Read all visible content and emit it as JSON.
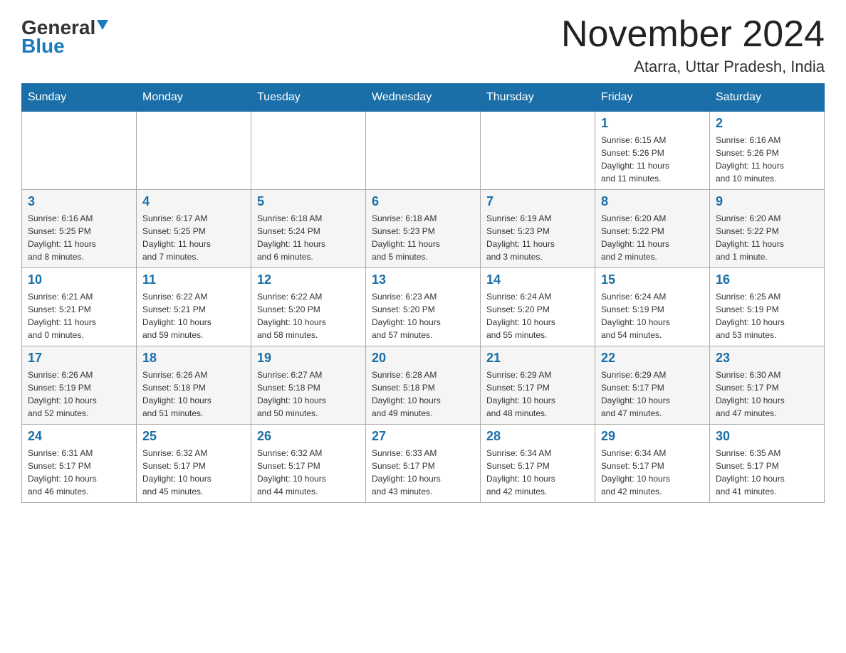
{
  "header": {
    "logo_general": "General",
    "logo_blue": "Blue",
    "month_title": "November 2024",
    "location": "Atarra, Uttar Pradesh, India"
  },
  "weekdays": [
    "Sunday",
    "Monday",
    "Tuesday",
    "Wednesday",
    "Thursday",
    "Friday",
    "Saturday"
  ],
  "weeks": [
    [
      {
        "day": "",
        "info": ""
      },
      {
        "day": "",
        "info": ""
      },
      {
        "day": "",
        "info": ""
      },
      {
        "day": "",
        "info": ""
      },
      {
        "day": "",
        "info": ""
      },
      {
        "day": "1",
        "info": "Sunrise: 6:15 AM\nSunset: 5:26 PM\nDaylight: 11 hours\nand 11 minutes."
      },
      {
        "day": "2",
        "info": "Sunrise: 6:16 AM\nSunset: 5:26 PM\nDaylight: 11 hours\nand 10 minutes."
      }
    ],
    [
      {
        "day": "3",
        "info": "Sunrise: 6:16 AM\nSunset: 5:25 PM\nDaylight: 11 hours\nand 8 minutes."
      },
      {
        "day": "4",
        "info": "Sunrise: 6:17 AM\nSunset: 5:25 PM\nDaylight: 11 hours\nand 7 minutes."
      },
      {
        "day": "5",
        "info": "Sunrise: 6:18 AM\nSunset: 5:24 PM\nDaylight: 11 hours\nand 6 minutes."
      },
      {
        "day": "6",
        "info": "Sunrise: 6:18 AM\nSunset: 5:23 PM\nDaylight: 11 hours\nand 5 minutes."
      },
      {
        "day": "7",
        "info": "Sunrise: 6:19 AM\nSunset: 5:23 PM\nDaylight: 11 hours\nand 3 minutes."
      },
      {
        "day": "8",
        "info": "Sunrise: 6:20 AM\nSunset: 5:22 PM\nDaylight: 11 hours\nand 2 minutes."
      },
      {
        "day": "9",
        "info": "Sunrise: 6:20 AM\nSunset: 5:22 PM\nDaylight: 11 hours\nand 1 minute."
      }
    ],
    [
      {
        "day": "10",
        "info": "Sunrise: 6:21 AM\nSunset: 5:21 PM\nDaylight: 11 hours\nand 0 minutes."
      },
      {
        "day": "11",
        "info": "Sunrise: 6:22 AM\nSunset: 5:21 PM\nDaylight: 10 hours\nand 59 minutes."
      },
      {
        "day": "12",
        "info": "Sunrise: 6:22 AM\nSunset: 5:20 PM\nDaylight: 10 hours\nand 58 minutes."
      },
      {
        "day": "13",
        "info": "Sunrise: 6:23 AM\nSunset: 5:20 PM\nDaylight: 10 hours\nand 57 minutes."
      },
      {
        "day": "14",
        "info": "Sunrise: 6:24 AM\nSunset: 5:20 PM\nDaylight: 10 hours\nand 55 minutes."
      },
      {
        "day": "15",
        "info": "Sunrise: 6:24 AM\nSunset: 5:19 PM\nDaylight: 10 hours\nand 54 minutes."
      },
      {
        "day": "16",
        "info": "Sunrise: 6:25 AM\nSunset: 5:19 PM\nDaylight: 10 hours\nand 53 minutes."
      }
    ],
    [
      {
        "day": "17",
        "info": "Sunrise: 6:26 AM\nSunset: 5:19 PM\nDaylight: 10 hours\nand 52 minutes."
      },
      {
        "day": "18",
        "info": "Sunrise: 6:26 AM\nSunset: 5:18 PM\nDaylight: 10 hours\nand 51 minutes."
      },
      {
        "day": "19",
        "info": "Sunrise: 6:27 AM\nSunset: 5:18 PM\nDaylight: 10 hours\nand 50 minutes."
      },
      {
        "day": "20",
        "info": "Sunrise: 6:28 AM\nSunset: 5:18 PM\nDaylight: 10 hours\nand 49 minutes."
      },
      {
        "day": "21",
        "info": "Sunrise: 6:29 AM\nSunset: 5:17 PM\nDaylight: 10 hours\nand 48 minutes."
      },
      {
        "day": "22",
        "info": "Sunrise: 6:29 AM\nSunset: 5:17 PM\nDaylight: 10 hours\nand 47 minutes."
      },
      {
        "day": "23",
        "info": "Sunrise: 6:30 AM\nSunset: 5:17 PM\nDaylight: 10 hours\nand 47 minutes."
      }
    ],
    [
      {
        "day": "24",
        "info": "Sunrise: 6:31 AM\nSunset: 5:17 PM\nDaylight: 10 hours\nand 46 minutes."
      },
      {
        "day": "25",
        "info": "Sunrise: 6:32 AM\nSunset: 5:17 PM\nDaylight: 10 hours\nand 45 minutes."
      },
      {
        "day": "26",
        "info": "Sunrise: 6:32 AM\nSunset: 5:17 PM\nDaylight: 10 hours\nand 44 minutes."
      },
      {
        "day": "27",
        "info": "Sunrise: 6:33 AM\nSunset: 5:17 PM\nDaylight: 10 hours\nand 43 minutes."
      },
      {
        "day": "28",
        "info": "Sunrise: 6:34 AM\nSunset: 5:17 PM\nDaylight: 10 hours\nand 42 minutes."
      },
      {
        "day": "29",
        "info": "Sunrise: 6:34 AM\nSunset: 5:17 PM\nDaylight: 10 hours\nand 42 minutes."
      },
      {
        "day": "30",
        "info": "Sunrise: 6:35 AM\nSunset: 5:17 PM\nDaylight: 10 hours\nand 41 minutes."
      }
    ]
  ]
}
